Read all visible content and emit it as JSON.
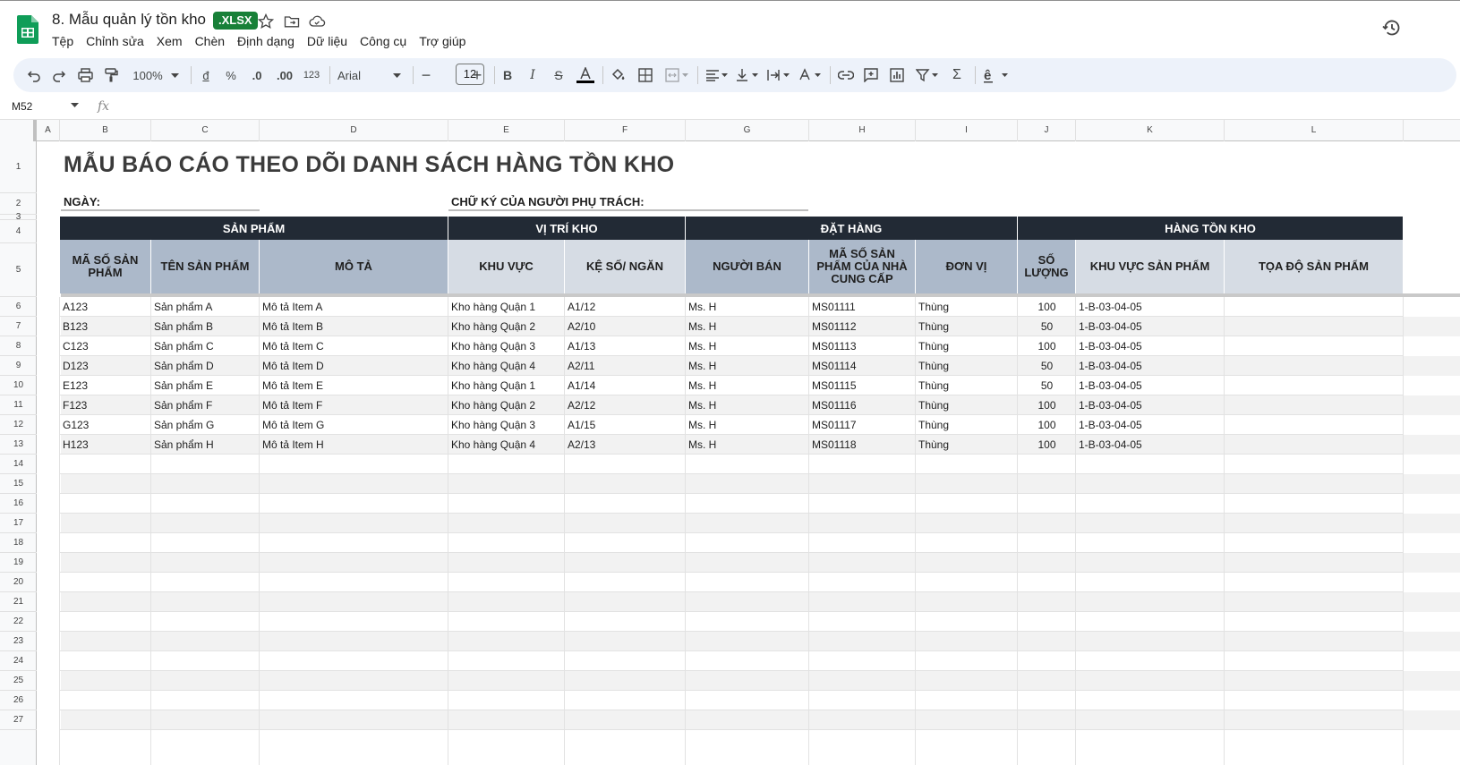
{
  "document": {
    "title": "8. Mẫu quản lý tồn kho",
    "extension_badge": ".XLSX"
  },
  "menu": [
    "Tệp",
    "Chỉnh sửa",
    "Xem",
    "Chèn",
    "Định dạng",
    "Dữ liệu",
    "Công cụ",
    "Trợ giúp"
  ],
  "toolbar": {
    "zoom": "100%",
    "currency": "đ",
    "percent": "%",
    "decrease_decimal": ".0",
    "increase_decimal": ".00",
    "number_format": "123",
    "font": "Arial",
    "font_size": "12"
  },
  "formula_bar": {
    "cell_ref": "M52",
    "fx": "fx"
  },
  "columns": [
    "A",
    "B",
    "C",
    "D",
    "E",
    "F",
    "G",
    "H",
    "I",
    "J",
    "K",
    "L"
  ],
  "rows": [
    "1",
    "2",
    "3",
    "4",
    "5",
    "6",
    "7",
    "8",
    "9",
    "10",
    "11",
    "12",
    "13",
    "14",
    "15",
    "16",
    "17",
    "18",
    "19",
    "20",
    "21",
    "22",
    "23",
    "24",
    "25",
    "26",
    "27"
  ],
  "sheet": {
    "title": "MẪU BÁO CÁO THEO DÕI DANH SÁCH HÀNG TỒN KHO",
    "date_label": "NGÀY:",
    "signature_label": "CHỮ KÝ CỦA NGƯỜI PHỤ TRÁCH:",
    "groups": [
      "SẢN PHẨM",
      "VỊ TRÍ KHO",
      "ĐẶT HÀNG",
      "HÀNG TỒN KHO"
    ],
    "headers": [
      "MÃ SỐ SẢN PHẨM",
      "TÊN SẢN PHẨM",
      "MÔ TẢ",
      "KHU VỰC",
      "KỆ SỐ/ NGĂN",
      "NGƯỜI BÁN",
      "MÃ SỐ SẢN PHẨM CỦA NHÀ CUNG CẤP",
      "ĐƠN VỊ",
      "SỐ LƯỢNG",
      "KHU VỰC SẢN PHẨM",
      "TỌA ĐỘ SẢN PHẨM"
    ],
    "data": [
      [
        "A123",
        "Sản phẩm A",
        "Mô tả Item A",
        "Kho hàng Quận 1",
        "A1/12",
        "Ms. H",
        "MS01111",
        "Thùng",
        "100",
        "1-B-03-04-05",
        ""
      ],
      [
        "B123",
        "Sản phẩm B",
        "Mô tả Item B",
        "Kho hàng Quận 2",
        "A2/10",
        "Ms. H",
        "MS01112",
        "Thùng",
        "50",
        "1-B-03-04-05",
        ""
      ],
      [
        "C123",
        "Sản phẩm C",
        "Mô tả Item C",
        "Kho hàng Quận 3",
        "A1/13",
        "Ms. H",
        "MS01113",
        "Thùng",
        "100",
        "1-B-03-04-05",
        ""
      ],
      [
        "D123",
        "Sản phẩm D",
        "Mô tả Item D",
        "Kho hàng Quận 4",
        "A2/11",
        "Ms. H",
        "MS01114",
        "Thùng",
        "50",
        "1-B-03-04-05",
        ""
      ],
      [
        "E123",
        "Sản phẩm E",
        "Mô tả Item E",
        "Kho hàng Quận 1",
        "A1/14",
        "Ms. H",
        "MS01115",
        "Thùng",
        "50",
        "1-B-03-04-05",
        ""
      ],
      [
        "F123",
        "Sản phẩm F",
        "Mô tả Item F",
        "Kho hàng Quận 2",
        "A2/12",
        "Ms. H",
        "MS01116",
        "Thùng",
        "100",
        "1-B-03-04-05",
        ""
      ],
      [
        "G123",
        "Sản phẩm G",
        "Mô tả Item G",
        "Kho hàng Quận 3",
        "A1/15",
        "Ms. H",
        "MS01117",
        "Thùng",
        "100",
        "1-B-03-04-05",
        ""
      ],
      [
        "H123",
        "Sản phẩm H",
        "Mô tả Item H",
        "Kho hàng Quận 4",
        "A2/13",
        "Ms. H",
        "MS01118",
        "Thùng",
        "100",
        "1-B-03-04-05",
        ""
      ]
    ]
  },
  "colors": {
    "group_header": "#222a35",
    "column_header": "#acb9ca",
    "column_header_light": "#d6dce4",
    "sheets_green": "#188038"
  }
}
